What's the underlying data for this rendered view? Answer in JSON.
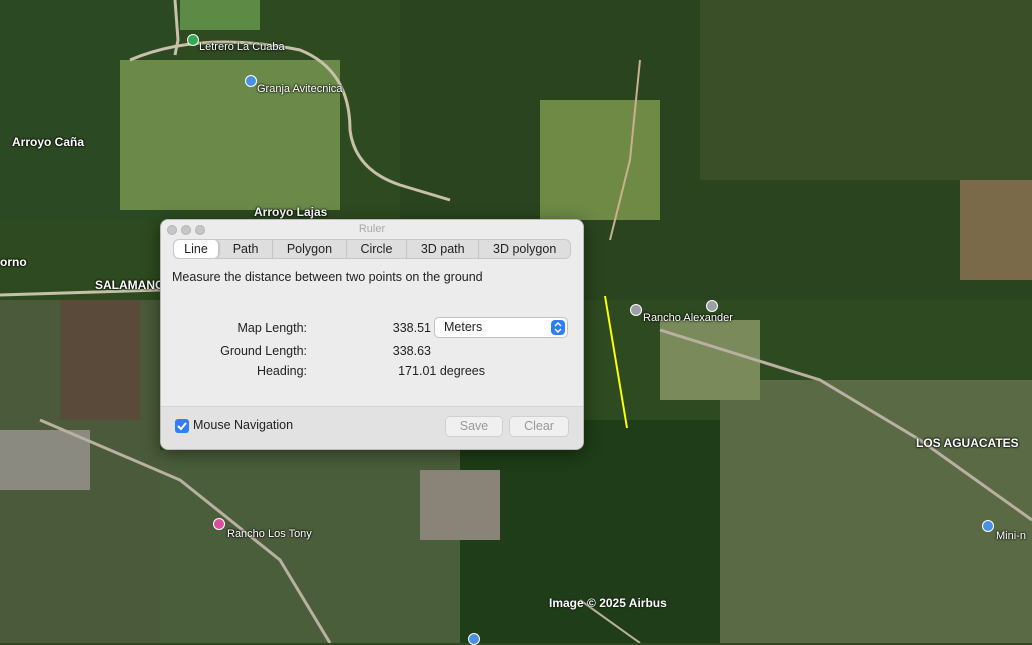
{
  "map": {
    "places": [
      {
        "name": "Letrero La Cuaba"
      },
      {
        "name": "Granja Avitecnica"
      },
      {
        "name": "Arroyo Caña"
      },
      {
        "name": "Arroyo Lajas"
      },
      {
        "name": "orno"
      },
      {
        "name": "SALAMANC"
      },
      {
        "name": "Rancho Alexander"
      },
      {
        "name": "LOS AGUACATES"
      },
      {
        "name": "Rancho Los Tony"
      },
      {
        "name": "Mini-n"
      }
    ],
    "credit": "Image © 2025 Airbus",
    "colors": {
      "measure_line": "#ffff00"
    }
  },
  "ruler": {
    "title": "Ruler",
    "tabs": [
      "Line",
      "Path",
      "Polygon",
      "Circle",
      "3D path",
      "3D polygon"
    ],
    "active_tab": "Line",
    "description": "Measure the distance between two points on the ground",
    "map_length_label": "Map Length:",
    "map_length_value": "338.51",
    "ground_length_label": "Ground Length:",
    "ground_length_value": "338.63",
    "heading_label": "Heading:",
    "heading_value": "171.01 degrees",
    "units": "Meters",
    "mouse_navigation_label": "Mouse Navigation",
    "mouse_navigation_checked": true,
    "save_label": "Save",
    "clear_label": "Clear",
    "colors": {
      "accent": "#2f7ef6"
    }
  }
}
